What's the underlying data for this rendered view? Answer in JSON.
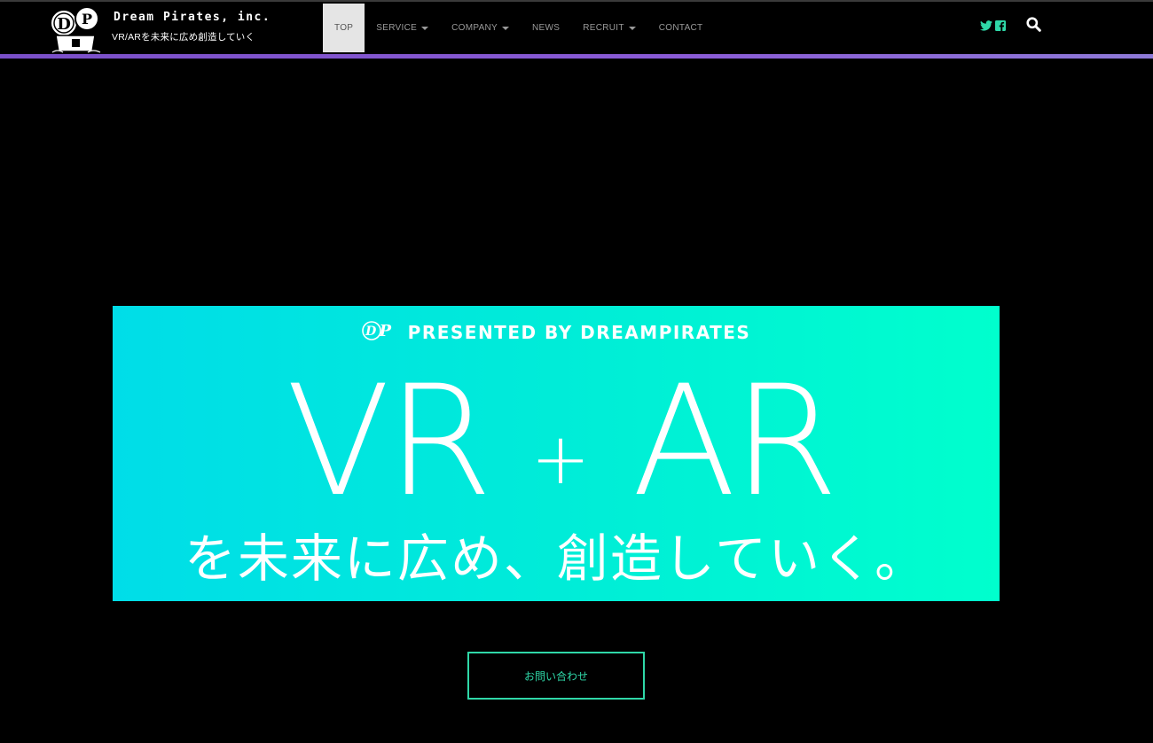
{
  "header": {
    "brand_name": "Dream Pirates, inc.",
    "tagline": "VR/ARを未来に広め創造していく",
    "logo_icon": "dp-treasure-logo-icon"
  },
  "nav": {
    "items": [
      {
        "label": "TOP",
        "active": true,
        "dropdown": false
      },
      {
        "label": "SERVICE",
        "active": false,
        "dropdown": true
      },
      {
        "label": "COMPANY",
        "active": false,
        "dropdown": true
      },
      {
        "label": "NEWS",
        "active": false,
        "dropdown": false
      },
      {
        "label": "RECRUIT",
        "active": false,
        "dropdown": true
      },
      {
        "label": "CONTACT",
        "active": false,
        "dropdown": false
      }
    ]
  },
  "social": {
    "twitter_icon": "twitter-icon",
    "facebook_icon": "facebook-icon",
    "search_icon": "search-icon",
    "color": "#2fd8a8"
  },
  "banner": {
    "presented": "PRESENTED BY DREAMPIRATES",
    "mini_logo": "DP",
    "main_left": "VR",
    "main_plus": "+",
    "main_right": "AR",
    "subtitle": "を未来に広め、創造していく。"
  },
  "cta": {
    "label": "お問い合わせ",
    "color": "#2fd8a8"
  }
}
